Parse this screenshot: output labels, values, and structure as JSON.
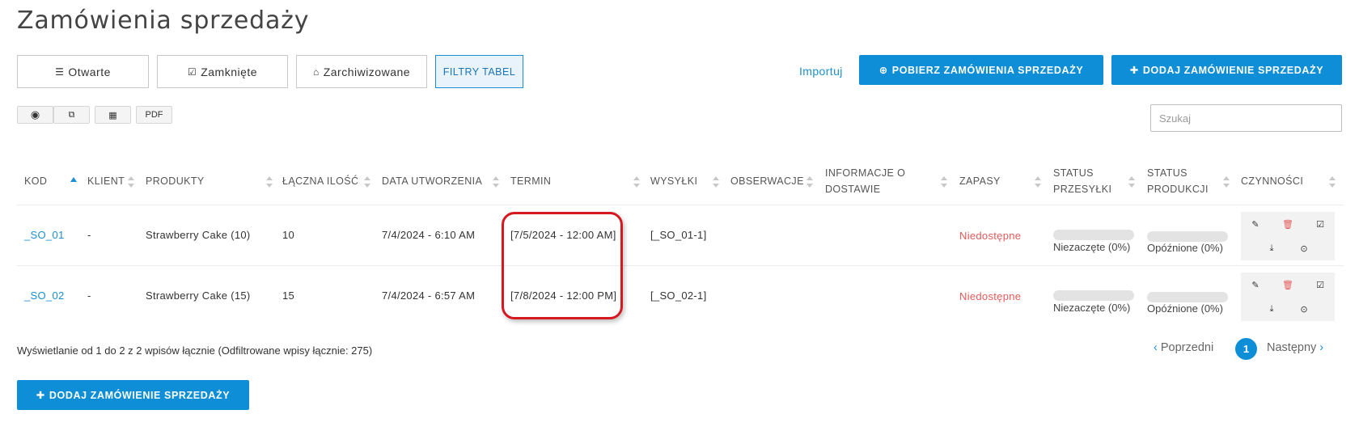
{
  "page": {
    "title": "Zamówienia sprzedaży"
  },
  "tabs": [
    {
      "label": "Otwarte",
      "icon": "list-icon"
    },
    {
      "label": "Zamknięte",
      "icon": "check-square-icon"
    },
    {
      "label": "Zarchiwizowane",
      "icon": "archive-icon"
    },
    {
      "label": "FILTRY TABEL"
    }
  ],
  "toolbar": {
    "import_label": "Importuj",
    "fetch_label": "POBIERZ ZAMÓWIENIA SPRZEDAŻY",
    "add_label": "DODAJ ZAMÓWIENIE SPRZEDAŻY",
    "pdf_label": "PDF",
    "search_placeholder": "Szukaj"
  },
  "table": {
    "headers": {
      "kod": "KOD",
      "klient": "KLIENT",
      "produkty": "PRODUKTY",
      "ilosc": "ŁĄCZNA ILOŚĆ",
      "data": "DATA UTWORZENIA",
      "termin": "TERMIN",
      "wysylki": "WYSYŁKI",
      "obserwacje": "OBSERWACJE",
      "informacje_1": "INFORMACJE O",
      "informacje_2": "DOSTAWIE",
      "zapasy": "ZAPASY",
      "status_przesylki_1": "STATUS",
      "status_przesylki_2": "PRZESYŁKI",
      "status_produkcji_1": "STATUS",
      "status_produkcji_2": "PRODUKCJI",
      "czynnosci": "CZYNNOŚCI"
    },
    "rows": [
      {
        "kod": "_SO_01",
        "klient": "-",
        "produkty": "Strawberry Cake (10)",
        "ilosc": "10",
        "data": "7/4/2024 - 6:10 AM",
        "termin": "[7/5/2024 - 12:00 AM]",
        "wysylki": "[_SO_01-1]",
        "zapasy": "Niedostępne",
        "shipment_label": "Niezaczęte (0%)",
        "shipment_progress": 0,
        "production_label": "Opóźnione (0%)",
        "production_progress": 0
      },
      {
        "kod": "_SO_02",
        "klient": "-",
        "produkty": "Strawberry Cake (15)",
        "ilosc": "15",
        "data": "7/4/2024 - 6:57 AM",
        "termin": "[7/8/2024 - 12:00 PM]",
        "wysylki": "[_SO_02-1]",
        "zapasy": "Niedostępne",
        "shipment_label": "Niezaczęte (0%)",
        "shipment_progress": 0,
        "production_label": "Opóźnione (0%)",
        "production_progress": 0
      }
    ]
  },
  "footer": {
    "info": "Wyświetlanie od 1 do 2 z 2 wpisów łącznie (Odfiltrowane wpisy łącznie: 275)",
    "prev_label": "Poprzedni",
    "current_page": "1",
    "next_label": "Następny",
    "add_label": "DODAJ ZAMÓWIENIE SPRZEDAŻY"
  },
  "colors": {
    "primary": "#0d8ed6",
    "link": "#1b8fd0",
    "danger": "#e55a5a",
    "highlight": "#d61820"
  }
}
